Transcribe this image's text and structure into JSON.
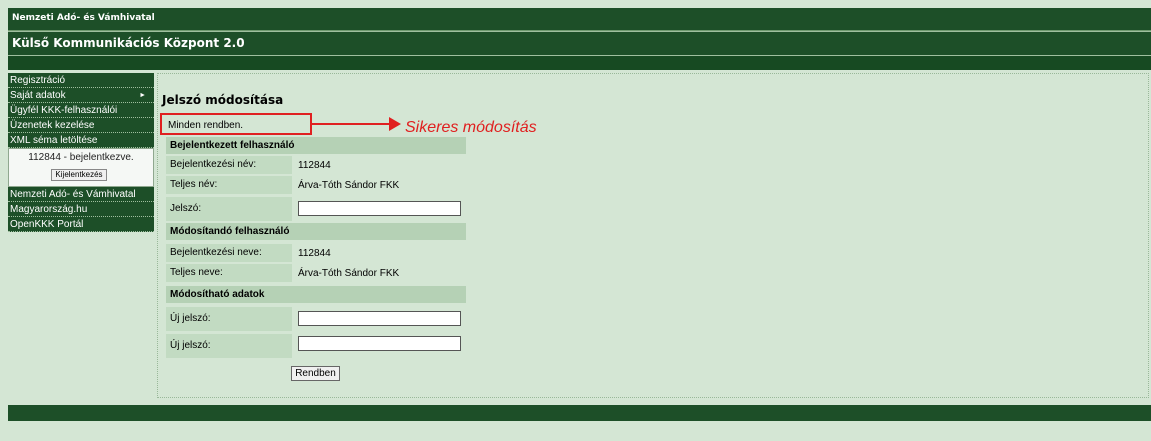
{
  "header": {
    "org_name": "Nemzeti Adó- és Vámhivatal",
    "app_title": "Külső Kommunikációs Központ 2.0"
  },
  "sidebar": {
    "items_top": [
      {
        "label": "Regisztráció"
      },
      {
        "label": "Saját adatok",
        "arrow": "►"
      },
      {
        "label": "Ügyfél KKK-felhasználói"
      },
      {
        "label": "Üzenetek kezelése"
      },
      {
        "label": "XML séma letöltése"
      }
    ],
    "login_status": "112844 - bejelentkezve.",
    "logout_label": "Kijelentkezés",
    "items_bottom": [
      {
        "label": "Nemzeti Adó- és Vámhivatal"
      },
      {
        "label": "Magyarország.hu"
      },
      {
        "label": "OpenKKK Portál"
      }
    ]
  },
  "main": {
    "title": "Jelszó módosítása",
    "message": "Minden rendben.",
    "annotation": "Sikeres módosítás",
    "sections": {
      "logged_in": "Bejelentkezett felhasználó",
      "target": "Módosítandó felhasználó",
      "editable": "Módosítható adatok"
    },
    "logged_in": {
      "login_label": "Bejelentkezési név:",
      "login_value": "112844",
      "fullname_label": "Teljes név:",
      "fullname_value": "Árva-Tóth Sándor FKK",
      "password_label": "Jelszó:",
      "password_value": ""
    },
    "target": {
      "login_label": "Bejelentkezési neve:",
      "login_value": "112844",
      "fullname_label": "Teljes neve:",
      "fullname_value": "Árva-Tóth Sándor FKK"
    },
    "editable": {
      "new_password_label": "Új jelszó:",
      "new_password_value": "",
      "new_password2_label": "Új jelszó:",
      "new_password2_value": ""
    },
    "ok_label": "Rendben"
  },
  "colors": {
    "dark_green": "#1d4f28",
    "page_bg": "#d4e6d4",
    "section_header": "#b5d1b5",
    "label_cell": "#c2dbc2",
    "annotation_red": "#e02020"
  }
}
